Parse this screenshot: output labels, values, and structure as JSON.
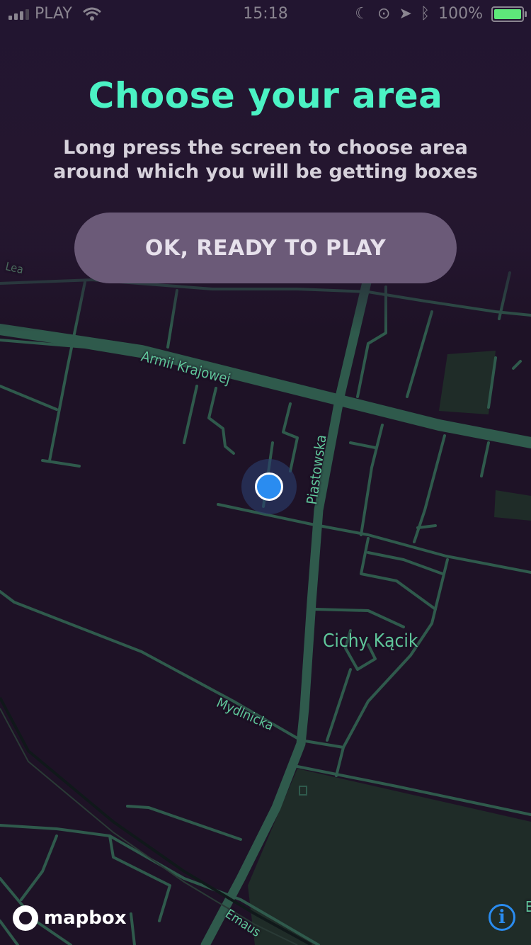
{
  "status_bar": {
    "carrier": "PLAY",
    "time": "15:18",
    "battery": "100%",
    "battery_level": 1.0
  },
  "header": {
    "title": "Choose your area",
    "subtitle": "Long press the screen to choose area around which you will be getting boxes"
  },
  "actions": {
    "ready_button": "OK, READY TO PLAY"
  },
  "map": {
    "labels": {
      "armii": "Armii Krajowej",
      "piastowska": "Piastowska",
      "cichy": "Cichy Kącik",
      "mydlnicka": "Mydlnicka",
      "emaus": "Emaus",
      "lea": "Lea",
      "edge": "E"
    },
    "attribution": "mapbox",
    "info_icon": "i",
    "colors": {
      "background": "#1e1226",
      "road": "#2f5a4c",
      "label": "#5fc79a",
      "accent": "#4bf2c4",
      "location": "#2a8cf0"
    }
  }
}
